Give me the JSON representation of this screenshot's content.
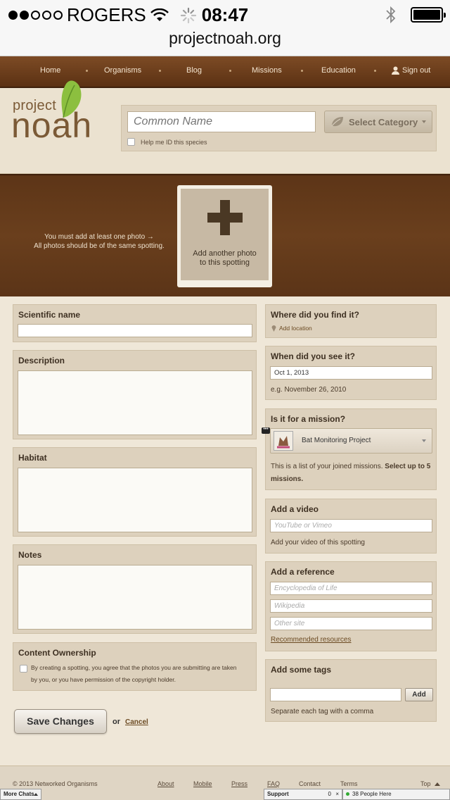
{
  "status_bar": {
    "carrier": "ROGERS",
    "time": "08:47",
    "signal_dots_filled": 2,
    "signal_dots_total": 5,
    "battery_level": 1.0
  },
  "url_bar": {
    "url": "projectnoah.org"
  },
  "nav": {
    "items": [
      "Home",
      "Organisms",
      "Blog",
      "Missions",
      "Education",
      "Sign out"
    ]
  },
  "logo": {
    "line1": "project",
    "line2": "noah"
  },
  "species": {
    "common_name_placeholder": "Common Name",
    "category_button": "Select Category",
    "help_id_label": "Help me ID this species"
  },
  "photos": {
    "hint_line1": "You must add at least one photo →",
    "hint_line2": "All photos should be of the same spotting.",
    "add_photo_line1": "Add another photo",
    "add_photo_line2": "to this spotting"
  },
  "left_panels": {
    "scientific_name": "Scientific name",
    "description": "Description",
    "habitat": "Habitat",
    "notes": "Notes",
    "content_ownership": "Content Ownership",
    "ownership_line1": "By creating a spotting, you agree that the photos you are submitting are taken",
    "ownership_line2": "by you, or you have permission of the copyright holder."
  },
  "right_panels": {
    "where_title": "Where did you find it?",
    "add_location": "Add location",
    "when_title": "When did you see it?",
    "date_value": "Oct  1, 2013",
    "date_example": "e.g. November 26, 2010",
    "mission_title": "Is it for a mission?",
    "mission_selected": "Bat Monitoring Project",
    "mission_info_plain": "This is a list of your joined missions.",
    "mission_info_bold1": "Select up",
    "mission_info_bold2": "to 5 missions.",
    "video_title": "Add a video",
    "video_placeholder": "YouTube or Vimeo",
    "video_help": "Add your video of this spotting",
    "reference_title": "Add a reference",
    "reference_placeholders": [
      "Encyclopedia of Life",
      "Wikipedia",
      "Other site"
    ],
    "recommended_link": "Recommended resources",
    "tags_title": "Add some tags",
    "tags_add_button": "Add",
    "tags_help": "Separate each tag with a comma"
  },
  "actions": {
    "save": "Save Changes",
    "or": "or",
    "cancel": "Cancel"
  },
  "footer": {
    "copyright": "© 2013 Networked Organisms",
    "links": [
      "About",
      "Mobile",
      "Press",
      "FAQ",
      "Contact",
      "Terms"
    ],
    "top": "Top"
  },
  "facebook_bar": {
    "more_chats": "More Chats",
    "support": "Support",
    "support_count": "0",
    "people_here": "38 People Here"
  }
}
